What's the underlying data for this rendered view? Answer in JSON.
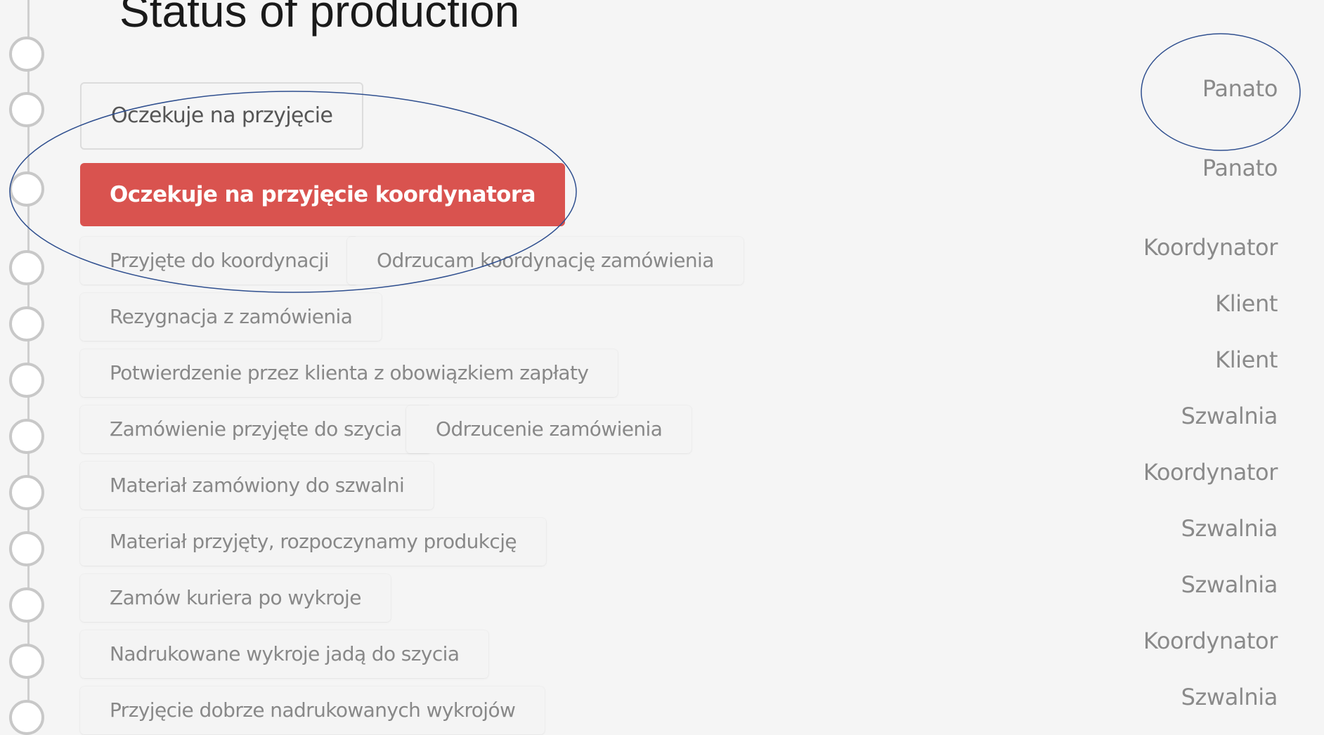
{
  "title": "Status of production",
  "statuses": [
    {
      "label": "Oczekuje na przyjęcie",
      "role": "Panato"
    },
    {
      "label": "Oczekuje na przyjęcie koordynatora",
      "role": "Panato"
    },
    {
      "label": "Przyjęte do koordynacji",
      "alt_label": "Odrzucam koordynację zamówienia",
      "role": "Koordynator"
    },
    {
      "label": "Rezygnacja z zamówienia",
      "role": "Klient"
    },
    {
      "label": "Potwierdzenie przez klienta z obowiązkiem zapłaty",
      "role": "Klient"
    },
    {
      "label": "Zamówienie przyjęte do szycia",
      "alt_label": "Odrzucenie zamówienia",
      "role": "Szwalnia"
    },
    {
      "label": "Materiał zamówiony do szwalni",
      "role": "Koordynator"
    },
    {
      "label": "Materiał przyjęty, rozpoczynamy produkcję",
      "role": "Szwalnia"
    },
    {
      "label": "Zamów kuriera po wykroje",
      "role": "Szwalnia"
    },
    {
      "label": "Nadrukowane wykroje jadą do szycia",
      "role": "Koordynator"
    },
    {
      "label": "Przyjęcie dobrze nadrukowanych wykrojów",
      "role": "Szwalnia"
    }
  ],
  "colors": {
    "active": "#d9534f",
    "annotation": "#2f4f8f"
  }
}
